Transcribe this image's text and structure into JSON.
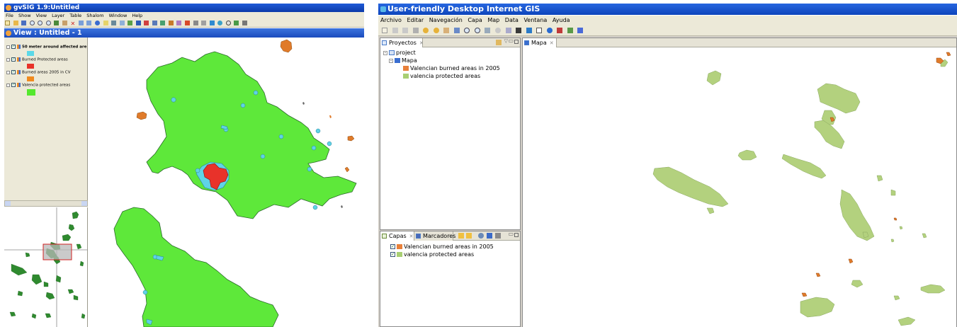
{
  "gvsig": {
    "title": "gvSIG 1.9:Untitled",
    "menu": [
      "File",
      "Show",
      "View",
      "Layer",
      "Table",
      "Shalom",
      "Window",
      "Help"
    ],
    "view_title": "View : Untitled - 1",
    "toc": [
      {
        "label": "50 meter around affected are",
        "color": "#5bd8e8"
      },
      {
        "label": "Burned Protected areas",
        "color": "#e8322a"
      },
      {
        "label": "Burned areas 2005 in CV",
        "color": "#f08a1e"
      },
      {
        "label": "Valencia protected areas",
        "color": "#55e82e"
      }
    ]
  },
  "udig": {
    "title": "User-friendly Desktop Internet GIS",
    "menu": [
      "Archivo",
      "Editar",
      "Navegación",
      "Capa",
      "Map",
      "Data",
      "Ventana",
      "Ayuda"
    ],
    "projects_tab": "Proyectos",
    "tree": {
      "project": "project",
      "map": "Mapa",
      "layers": [
        "Valencian burned areas in 2005",
        "valencia protected areas"
      ]
    },
    "layers_tab": "Capas",
    "bookmarks_tab": "Marcadores",
    "layers": [
      {
        "label": "Valencian burned areas in 2005",
        "color": "#e8803a",
        "checked": true
      },
      {
        "label": "valencia protected areas",
        "color": "#a8cf73",
        "checked": true
      }
    ],
    "map_tab": "Mapa"
  },
  "colors": {
    "green_polygon": "#5ee83a",
    "cyan_buffer": "#5fd3e6",
    "burned_red": "#e8322a",
    "burned_orange": "#e07b2a",
    "udig_green": "#b3d17e"
  }
}
